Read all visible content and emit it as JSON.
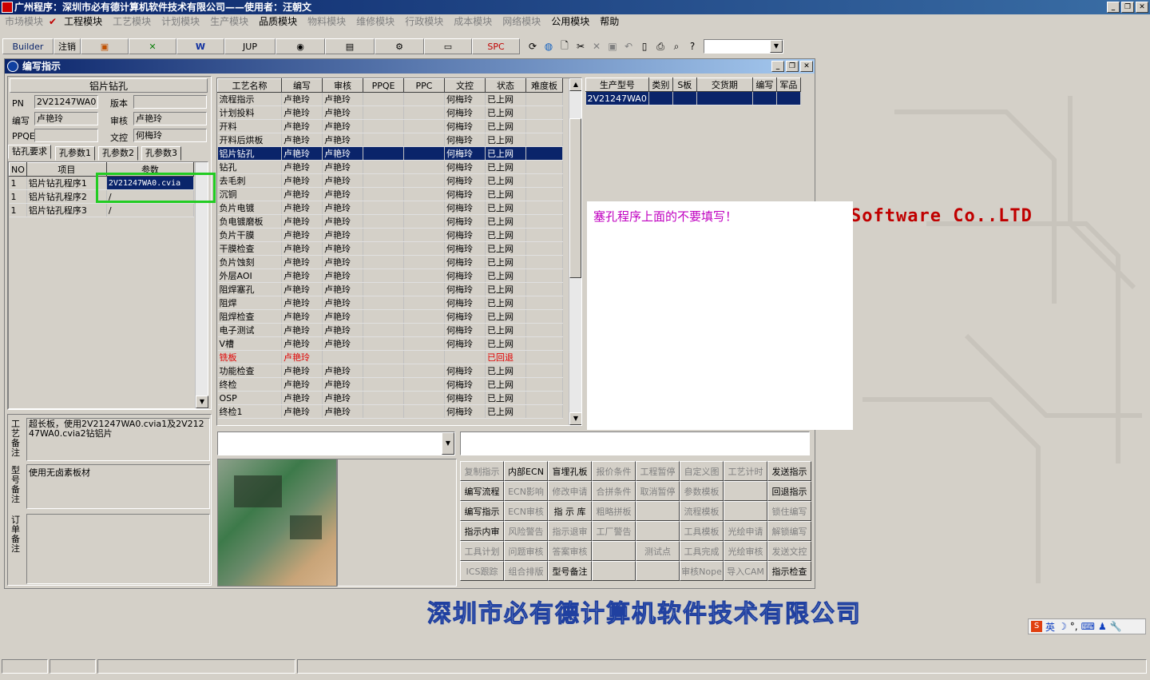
{
  "app": {
    "title": "广州程序：深圳市必有德计算机软件技术有限公司——使用者：汪朝文"
  },
  "menu": [
    {
      "label": "市场模块",
      "active": false
    },
    {
      "label": "工程模块",
      "active": true
    },
    {
      "label": "工艺模块",
      "active": false
    },
    {
      "label": "计划模块",
      "active": false
    },
    {
      "label": "生产模块",
      "active": false
    },
    {
      "label": "品质模块",
      "active": true
    },
    {
      "label": "物料模块",
      "active": false
    },
    {
      "label": "维修模块",
      "active": false
    },
    {
      "label": "行政模块",
      "active": false
    },
    {
      "label": "成本模块",
      "active": false
    },
    {
      "label": "网络模块",
      "active": false
    },
    {
      "label": "公用模块",
      "active": true
    },
    {
      "label": "帮助",
      "active": true
    }
  ],
  "toolbar": {
    "builder": "Builder",
    "logout": "注销",
    "jup": "JUP",
    "spc": "SPC"
  },
  "window": {
    "title": "编写指示"
  },
  "left": {
    "section_title": "铝片钻孔",
    "pn_label": "PN",
    "pn_value": "2V21247WA0",
    "version_label": "版本",
    "version_value": "",
    "writer_label": "编写",
    "writer_value": "卢艳玲",
    "review_label": "审核",
    "review_value": "卢艳玲",
    "ppqe_label": "PPQE",
    "ppqe_value": "",
    "docctrl_label": "文控",
    "docctrl_value": "何梅玲",
    "tabs": [
      "钻孔要求",
      "孔参数1",
      "孔参数2",
      "孔参数3"
    ],
    "param_headers": [
      "NO",
      "项目",
      "参数"
    ],
    "params": [
      {
        "no": "1",
        "item": "铝片钻孔程序1",
        "value": "2V21247WA0.cvia"
      },
      {
        "no": "1",
        "item": "铝片钻孔程序2",
        "value": "/"
      },
      {
        "no": "1",
        "item": "铝片钻孔程序3",
        "value": "/"
      }
    ],
    "process_note_label": "工艺备注",
    "process_note": "超长板，使用2V21247WA0.cvia1及2V21247WA0.cvia2钻铝片",
    "model_note_label": "型号备注",
    "model_note": "使用无卤素板材",
    "order_note_label": "订单备注",
    "order_note": ""
  },
  "process_table": {
    "headers": [
      "工艺名称",
      "编写",
      "审核",
      "PPQE",
      "PPC",
      "文控",
      "状态",
      "难度板"
    ],
    "rows": [
      [
        "流程指示",
        "卢艳玲",
        "卢艳玲",
        "",
        "",
        "何梅玲",
        "已上网",
        ""
      ],
      [
        "计划投料",
        "卢艳玲",
        "卢艳玲",
        "",
        "",
        "何梅玲",
        "已上网",
        ""
      ],
      [
        "开料",
        "卢艳玲",
        "卢艳玲",
        "",
        "",
        "何梅玲",
        "已上网",
        ""
      ],
      [
        "开料后烘板",
        "卢艳玲",
        "卢艳玲",
        "",
        "",
        "何梅玲",
        "已上网",
        ""
      ],
      [
        "铝片钻孔",
        "卢艳玲",
        "卢艳玲",
        "",
        "",
        "何梅玲",
        "已上网",
        ""
      ],
      [
        "钻孔",
        "卢艳玲",
        "卢艳玲",
        "",
        "",
        "何梅玲",
        "已上网",
        ""
      ],
      [
        "去毛刺",
        "卢艳玲",
        "卢艳玲",
        "",
        "",
        "何梅玲",
        "已上网",
        ""
      ],
      [
        "沉铜",
        "卢艳玲",
        "卢艳玲",
        "",
        "",
        "何梅玲",
        "已上网",
        ""
      ],
      [
        "负片电镀",
        "卢艳玲",
        "卢艳玲",
        "",
        "",
        "何梅玲",
        "已上网",
        ""
      ],
      [
        "负电镀磨板",
        "卢艳玲",
        "卢艳玲",
        "",
        "",
        "何梅玲",
        "已上网",
        ""
      ],
      [
        "负片干膜",
        "卢艳玲",
        "卢艳玲",
        "",
        "",
        "何梅玲",
        "已上网",
        ""
      ],
      [
        "干膜检查",
        "卢艳玲",
        "卢艳玲",
        "",
        "",
        "何梅玲",
        "已上网",
        ""
      ],
      [
        "负片蚀刻",
        "卢艳玲",
        "卢艳玲",
        "",
        "",
        "何梅玲",
        "已上网",
        ""
      ],
      [
        "外层AOI",
        "卢艳玲",
        "卢艳玲",
        "",
        "",
        "何梅玲",
        "已上网",
        ""
      ],
      [
        "阻焊塞孔",
        "卢艳玲",
        "卢艳玲",
        "",
        "",
        "何梅玲",
        "已上网",
        ""
      ],
      [
        "阻焊",
        "卢艳玲",
        "卢艳玲",
        "",
        "",
        "何梅玲",
        "已上网",
        ""
      ],
      [
        "阻焊检查",
        "卢艳玲",
        "卢艳玲",
        "",
        "",
        "何梅玲",
        "已上网",
        ""
      ],
      [
        "电子测试",
        "卢艳玲",
        "卢艳玲",
        "",
        "",
        "何梅玲",
        "已上网",
        ""
      ],
      [
        "V槽",
        "卢艳玲",
        "卢艳玲",
        "",
        "",
        "何梅玲",
        "已上网",
        ""
      ],
      [
        "铣板",
        "卢艳玲",
        "",
        "",
        "",
        "",
        "已回退",
        ""
      ],
      [
        "功能检查",
        "卢艳玲",
        "卢艳玲",
        "",
        "",
        "何梅玲",
        "已上网",
        ""
      ],
      [
        "终检",
        "卢艳玲",
        "卢艳玲",
        "",
        "",
        "何梅玲",
        "已上网",
        ""
      ],
      [
        "OSP",
        "卢艳玲",
        "卢艳玲",
        "",
        "",
        "何梅玲",
        "已上网",
        ""
      ],
      [
        "终检1",
        "卢艳玲",
        "卢艳玲",
        "",
        "",
        "何梅玲",
        "已上网",
        ""
      ]
    ]
  },
  "model_table": {
    "headers": [
      "生产型号",
      "类别",
      "S板",
      "交货期",
      "编写",
      "军品"
    ],
    "rows": [
      [
        "2V21247WA0",
        "",
        "",
        "",
        "",
        ""
      ]
    ]
  },
  "annotation": {
    "text": "塞孔程序上面的不要填写！"
  },
  "background": {
    "brand_en": "Software Co.,LTD",
    "brand_cn": "深圳市必有德计算机软件技术有限公司"
  },
  "actions": [
    {
      "label": "复制指示",
      "enabled": false
    },
    {
      "label": "内部ECN",
      "enabled": true
    },
    {
      "label": "盲埋孔板",
      "enabled": true
    },
    {
      "label": "报价条件",
      "enabled": false
    },
    {
      "label": "工程暂停",
      "enabled": false
    },
    {
      "label": "自定义图",
      "enabled": false
    },
    {
      "label": "工艺计时",
      "enabled": false
    },
    {
      "label": "发送指示",
      "enabled": true
    },
    {
      "label": "编写流程",
      "enabled": true
    },
    {
      "label": "ECN影响",
      "enabled": false
    },
    {
      "label": "修改申请",
      "enabled": false
    },
    {
      "label": "合拼条件",
      "enabled": false
    },
    {
      "label": "取消暂停",
      "enabled": false
    },
    {
      "label": "参数模板",
      "enabled": false
    },
    {
      "label": "",
      "enabled": false
    },
    {
      "label": "回退指示",
      "enabled": true
    },
    {
      "label": "编写指示",
      "enabled": true
    },
    {
      "label": "ECN审核",
      "enabled": false
    },
    {
      "label": "指 示 库",
      "enabled": true
    },
    {
      "label": "粗略拼板",
      "enabled": false
    },
    {
      "label": "",
      "enabled": false
    },
    {
      "label": "流程模板",
      "enabled": false
    },
    {
      "label": "",
      "enabled": false
    },
    {
      "label": "锁住编写",
      "enabled": false
    },
    {
      "label": "指示内审",
      "enabled": true
    },
    {
      "label": "风险警告",
      "enabled": false
    },
    {
      "label": "指示退审",
      "enabled": false
    },
    {
      "label": "工厂警告",
      "enabled": false
    },
    {
      "label": "",
      "enabled": false
    },
    {
      "label": "工具模板",
      "enabled": false
    },
    {
      "label": "光绘申请",
      "enabled": false
    },
    {
      "label": "解锁编写",
      "enabled": false
    },
    {
      "label": "工具计划",
      "enabled": false
    },
    {
      "label": "问题审核",
      "enabled": false
    },
    {
      "label": "答案审核",
      "enabled": false
    },
    {
      "label": "",
      "enabled": false
    },
    {
      "label": "测试点",
      "enabled": false
    },
    {
      "label": "工具完成",
      "enabled": false
    },
    {
      "label": "光绘审核",
      "enabled": false
    },
    {
      "label": "发送文控",
      "enabled": false
    },
    {
      "label": "ICS跟踪",
      "enabled": false
    },
    {
      "label": "组合排版",
      "enabled": false
    },
    {
      "label": "型号备注",
      "enabled": true
    },
    {
      "label": "",
      "enabled": false
    },
    {
      "label": "",
      "enabled": false
    },
    {
      "label": "审核Nope",
      "enabled": false
    },
    {
      "label": "导入CAM",
      "enabled": false
    },
    {
      "label": "指示检查",
      "enabled": true
    }
  ],
  "ime": {
    "lang": "英"
  },
  "colors": {
    "selection": "#0a246a",
    "annotation_text": "#c000c0",
    "brand": "#c00000",
    "highlight_box": "#22cc22",
    "rejected": "#e00000"
  }
}
